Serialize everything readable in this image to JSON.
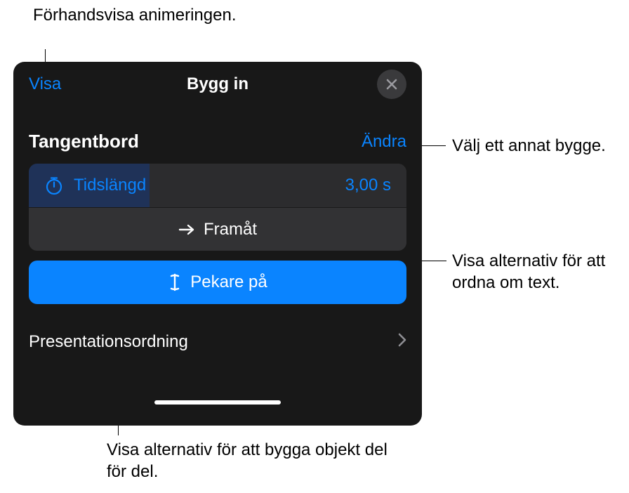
{
  "callouts": {
    "preview": "Förhandsvisa animeringen.",
    "change": "Välj ett annat bygge.",
    "direction": "Visa alternativ för att ordna om text.",
    "order": "Visa alternativ för att bygga objekt del för del."
  },
  "panel": {
    "preview_link": "Visa",
    "title": "Bygg in",
    "section_label": "Tangentbord",
    "change_link": "Ändra",
    "duration_label": "Tidslängd",
    "duration_value": "3,00 s",
    "direction_label": "Framåt",
    "pointer_label": "Pekare på",
    "order_label": "Presentationsordning"
  }
}
